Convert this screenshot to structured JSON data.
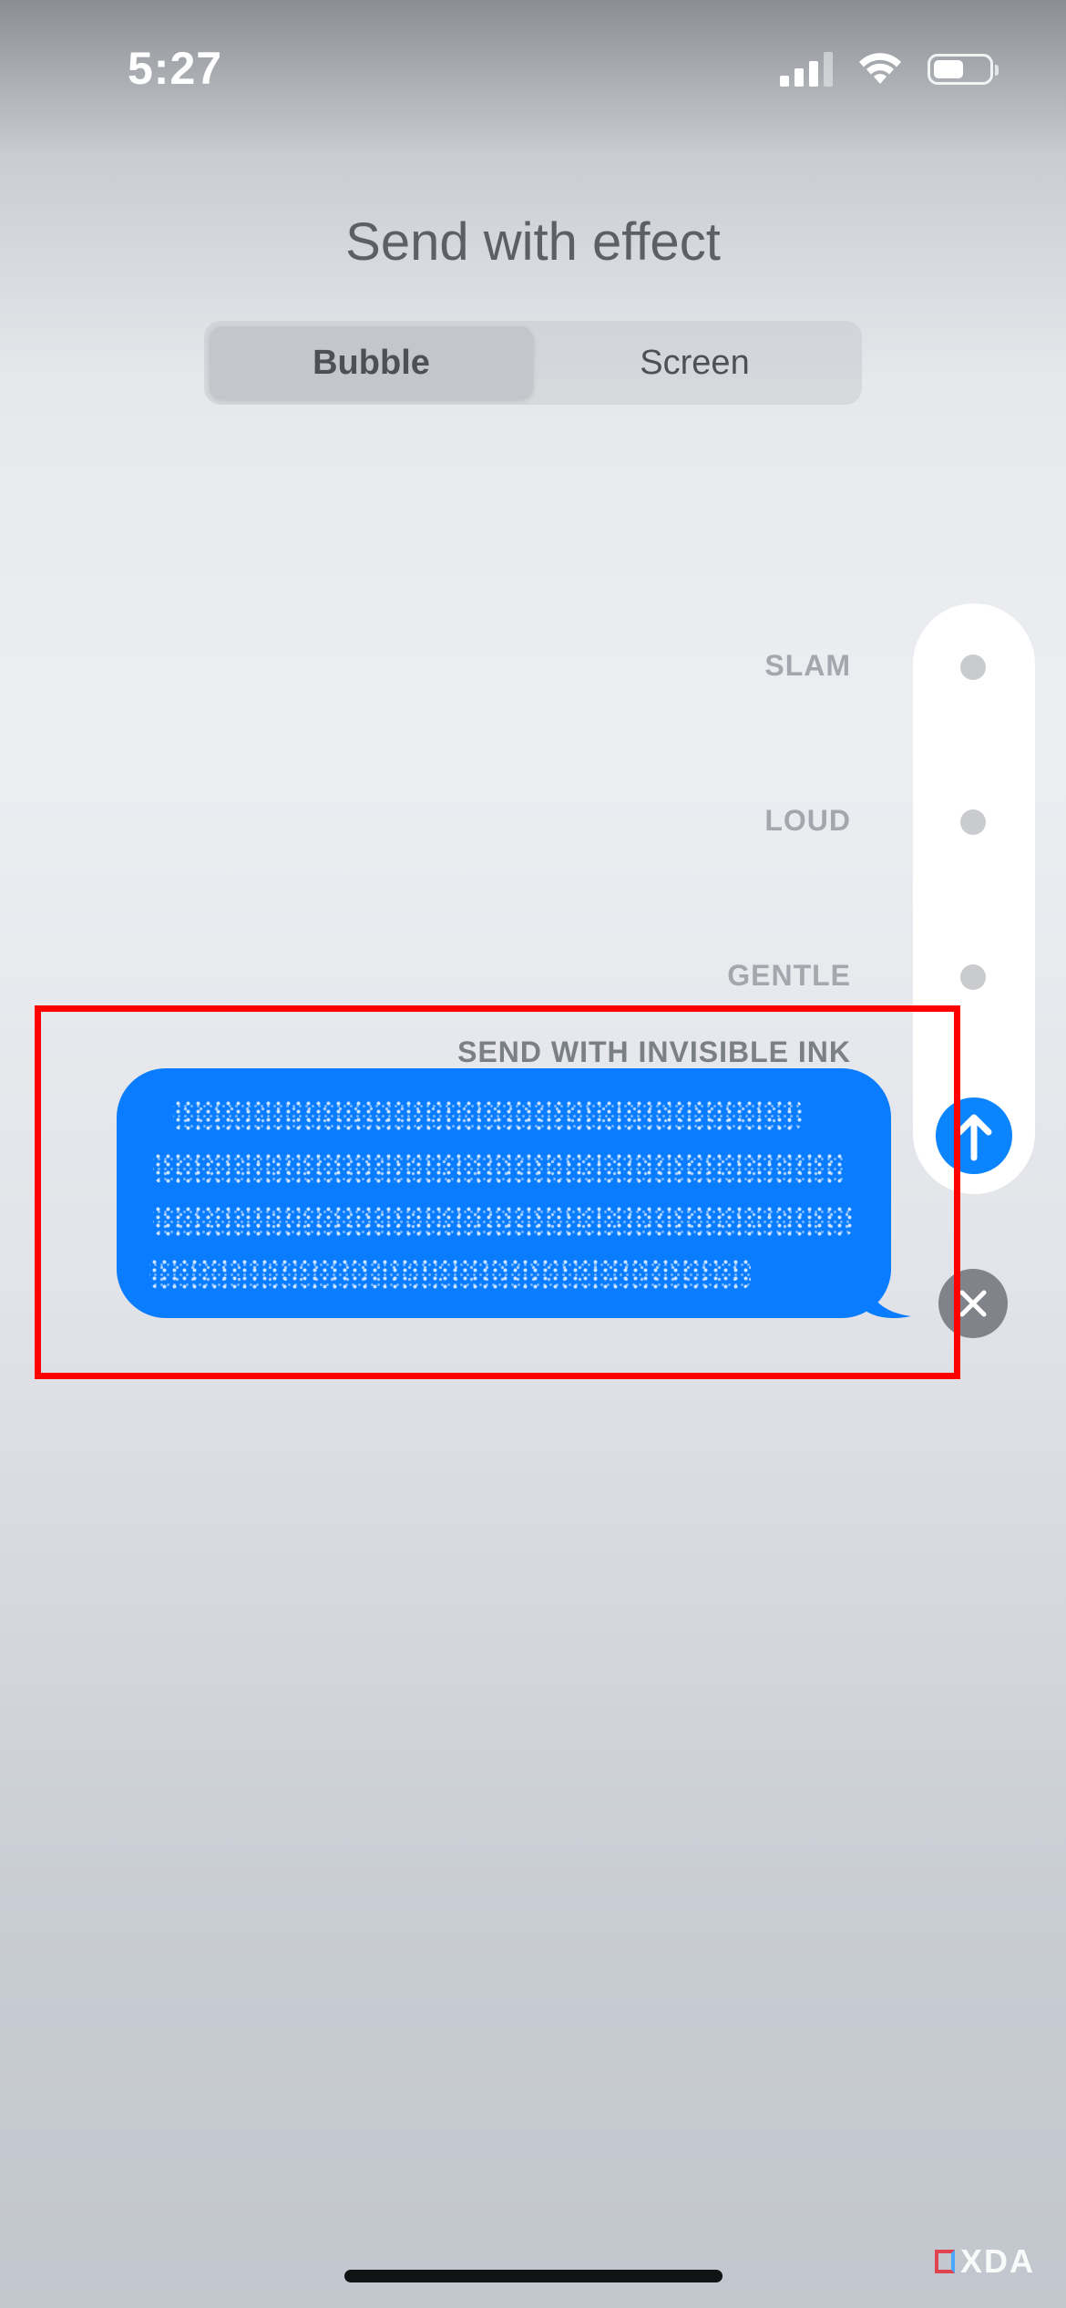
{
  "status_bar": {
    "time": "5:27",
    "icons": [
      "cellular-signal-icon",
      "wifi-icon",
      "battery-icon"
    ],
    "battery_fraction": 0.55
  },
  "header": {
    "title": "Send with effect"
  },
  "tabs": [
    {
      "label": "Bubble",
      "selected": true
    },
    {
      "label": "Screen",
      "selected": false
    }
  ],
  "effects": {
    "slam": "SLAM",
    "loud": "LOUD",
    "gentle": "GENTLE",
    "invisible_ink": "SEND WITH INVISIBLE INK",
    "selected": "invisible_ink"
  },
  "message": {
    "effect": "invisible ink (text obscured)"
  },
  "actions": {
    "send_icon": "arrow-up-icon",
    "cancel_icon": "close-icon"
  },
  "colors": {
    "bubble": "#0a7cff",
    "send_button": "#0a84ff",
    "highlight": "#ff0000"
  },
  "watermark": "XDA"
}
